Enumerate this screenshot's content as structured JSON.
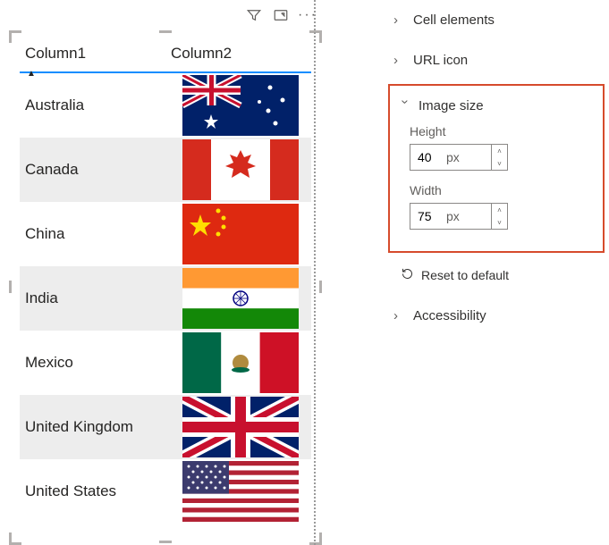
{
  "toolbar": {
    "filter_icon": "filter",
    "focus_icon": "focus-mode",
    "more_icon": "more"
  },
  "table": {
    "headers": {
      "col1": "Column1",
      "col2": "Column2"
    },
    "rows": [
      {
        "label": "Australia",
        "flag": "australia"
      },
      {
        "label": "Canada",
        "flag": "canada"
      },
      {
        "label": "China",
        "flag": "china"
      },
      {
        "label": "India",
        "flag": "india"
      },
      {
        "label": "Mexico",
        "flag": "mexico"
      },
      {
        "label": "United Kingdom",
        "flag": "uk"
      },
      {
        "label": "United States",
        "flag": "usa"
      }
    ]
  },
  "format": {
    "cell_elements": "Cell elements",
    "url_icon": "URL icon",
    "image_size": {
      "title": "Image size",
      "height_label": "Height",
      "height_value": "40",
      "height_unit": "px",
      "width_label": "Width",
      "width_value": "75",
      "width_unit": "px"
    },
    "reset": "Reset to default",
    "accessibility": "Accessibility"
  }
}
